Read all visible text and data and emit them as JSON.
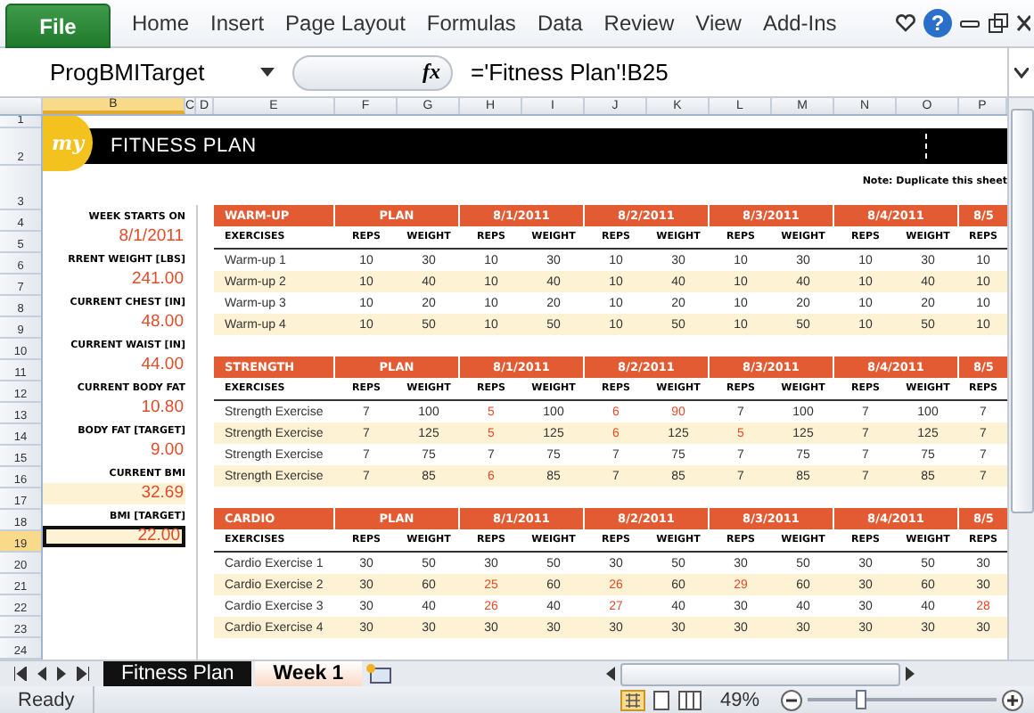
{
  "ribbon": {
    "file_label": "File",
    "tabs": [
      "Home",
      "Insert",
      "Page Layout",
      "Formulas",
      "Data",
      "Review",
      "View",
      "Add-Ins"
    ],
    "help_label": "?"
  },
  "formula_bar": {
    "name_box": "ProgBMITarget",
    "fx_label": "fx",
    "formula": "='Fitness Plan'!B25"
  },
  "column_headers": [
    {
      "label": "B",
      "selected": true
    },
    {
      "label": "C",
      "selected": false
    },
    {
      "label": "D",
      "selected": false
    },
    {
      "label": "E",
      "selected": false
    },
    {
      "label": "F",
      "selected": false
    },
    {
      "label": "G",
      "selected": false
    },
    {
      "label": "H",
      "selected": false
    },
    {
      "label": "I",
      "selected": false
    },
    {
      "label": "J",
      "selected": false
    },
    {
      "label": "K",
      "selected": false
    },
    {
      "label": "L",
      "selected": false
    },
    {
      "label": "M",
      "selected": false
    },
    {
      "label": "N",
      "selected": false
    },
    {
      "label": "O",
      "selected": false
    },
    {
      "label": "P",
      "selected": false
    }
  ],
  "row_headers": [
    {
      "label": "1",
      "selected": false
    },
    {
      "label": "2",
      "selected": false
    },
    {
      "label": "3",
      "selected": false
    },
    {
      "label": "4",
      "selected": false
    },
    {
      "label": "5",
      "selected": false
    },
    {
      "label": "6",
      "selected": false
    },
    {
      "label": "7",
      "selected": false
    },
    {
      "label": "8",
      "selected": false
    },
    {
      "label": "9",
      "selected": false
    },
    {
      "label": "10",
      "selected": false
    },
    {
      "label": "11",
      "selected": false
    },
    {
      "label": "12",
      "selected": false
    },
    {
      "label": "13",
      "selected": false
    },
    {
      "label": "14",
      "selected": false
    },
    {
      "label": "15",
      "selected": false
    },
    {
      "label": "16",
      "selected": false
    },
    {
      "label": "17",
      "selected": false
    },
    {
      "label": "18",
      "selected": false
    },
    {
      "label": "19",
      "selected": true
    },
    {
      "label": "20",
      "selected": false
    },
    {
      "label": "21",
      "selected": false
    },
    {
      "label": "22",
      "selected": false
    },
    {
      "label": "23",
      "selected": false
    },
    {
      "label": "24",
      "selected": false
    }
  ],
  "banner": {
    "logo": "my",
    "title": "FITNESS PLAN",
    "note": "Note: Duplicate this sheet"
  },
  "stats": [
    {
      "label": "WEEK STARTS ON",
      "value": "8/1/2011",
      "highlighted": false,
      "selected": false
    },
    {
      "label": "RRENT WEIGHT [LBS]",
      "value": "241.00",
      "highlighted": false,
      "selected": false
    },
    {
      "label": "CURRENT CHEST [IN]",
      "value": "48.00",
      "highlighted": false,
      "selected": false
    },
    {
      "label": "CURRENT WAIST [IN]",
      "value": "44.00",
      "highlighted": false,
      "selected": false
    },
    {
      "label": "CURRENT BODY FAT",
      "value": "10.80",
      "highlighted": false,
      "selected": false
    },
    {
      "label": "BODY FAT [TARGET]",
      "value": "9.00",
      "highlighted": false,
      "selected": false
    },
    {
      "label": "CURRENT BMI",
      "value": "32.69",
      "highlighted": true,
      "selected": false
    },
    {
      "label": "BMI [TARGET]",
      "value": "22.00",
      "highlighted": true,
      "selected": true
    }
  ],
  "sections": [
    {
      "title": "WARM-UP",
      "groups": [
        "PLAN",
        "8/1/2011",
        "8/2/2011",
        "8/3/2011",
        "8/4/2011",
        "8/5"
      ],
      "column_labels": [
        "EXERCISES",
        "REPS",
        "WEIGHT",
        "REPS",
        "WEIGHT",
        "REPS",
        "WEIGHT",
        "REPS",
        "WEIGHT",
        "REPS",
        "WEIGHT",
        "REPS"
      ],
      "rows": [
        {
          "exercise": "Warm-up 1",
          "cells": [
            {
              "text": "10",
              "flagged": false
            },
            {
              "text": "30",
              "flagged": false
            },
            {
              "text": "10",
              "flagged": false
            },
            {
              "text": "30",
              "flagged": false
            },
            {
              "text": "10",
              "flagged": false
            },
            {
              "text": "30",
              "flagged": false
            },
            {
              "text": "10",
              "flagged": false
            },
            {
              "text": "30",
              "flagged": false
            },
            {
              "text": "10",
              "flagged": false
            },
            {
              "text": "30",
              "flagged": false
            },
            {
              "text": "10",
              "flagged": false
            }
          ]
        },
        {
          "exercise": "Warm-up 2",
          "cells": [
            {
              "text": "10",
              "flagged": false
            },
            {
              "text": "40",
              "flagged": false
            },
            {
              "text": "10",
              "flagged": false
            },
            {
              "text": "40",
              "flagged": false
            },
            {
              "text": "10",
              "flagged": false
            },
            {
              "text": "40",
              "flagged": false
            },
            {
              "text": "10",
              "flagged": false
            },
            {
              "text": "40",
              "flagged": false
            },
            {
              "text": "10",
              "flagged": false
            },
            {
              "text": "40",
              "flagged": false
            },
            {
              "text": "10",
              "flagged": false
            }
          ]
        },
        {
          "exercise": "Warm-up 3",
          "cells": [
            {
              "text": "10",
              "flagged": false
            },
            {
              "text": "20",
              "flagged": false
            },
            {
              "text": "10",
              "flagged": false
            },
            {
              "text": "20",
              "flagged": false
            },
            {
              "text": "10",
              "flagged": false
            },
            {
              "text": "20",
              "flagged": false
            },
            {
              "text": "10",
              "flagged": false
            },
            {
              "text": "20",
              "flagged": false
            },
            {
              "text": "10",
              "flagged": false
            },
            {
              "text": "20",
              "flagged": false
            },
            {
              "text": "10",
              "flagged": false
            }
          ]
        },
        {
          "exercise": "Warm-up 4",
          "cells": [
            {
              "text": "10",
              "flagged": false
            },
            {
              "text": "50",
              "flagged": false
            },
            {
              "text": "10",
              "flagged": false
            },
            {
              "text": "50",
              "flagged": false
            },
            {
              "text": "10",
              "flagged": false
            },
            {
              "text": "50",
              "flagged": false
            },
            {
              "text": "10",
              "flagged": false
            },
            {
              "text": "50",
              "flagged": false
            },
            {
              "text": "10",
              "flagged": false
            },
            {
              "text": "50",
              "flagged": false
            },
            {
              "text": "10",
              "flagged": false
            }
          ]
        }
      ]
    },
    {
      "title": "STRENGTH",
      "groups": [
        "PLAN",
        "8/1/2011",
        "8/2/2011",
        "8/3/2011",
        "8/4/2011",
        "8/5"
      ],
      "column_labels": [
        "EXERCISES",
        "REPS",
        "WEIGHT",
        "REPS",
        "WEIGHT",
        "REPS",
        "WEIGHT",
        "REPS",
        "WEIGHT",
        "REPS",
        "WEIGHT",
        "REPS"
      ],
      "rows": [
        {
          "exercise": "Strength Exercise",
          "cells": [
            {
              "text": "7",
              "flagged": false
            },
            {
              "text": "100",
              "flagged": false
            },
            {
              "text": "5",
              "flagged": true
            },
            {
              "text": "100",
              "flagged": false
            },
            {
              "text": "6",
              "flagged": true
            },
            {
              "text": "90",
              "flagged": true
            },
            {
              "text": "7",
              "flagged": false
            },
            {
              "text": "100",
              "flagged": false
            },
            {
              "text": "7",
              "flagged": false
            },
            {
              "text": "100",
              "flagged": false
            },
            {
              "text": "7",
              "flagged": false
            }
          ]
        },
        {
          "exercise": "Strength Exercise",
          "cells": [
            {
              "text": "7",
              "flagged": false
            },
            {
              "text": "125",
              "flagged": false
            },
            {
              "text": "5",
              "flagged": true
            },
            {
              "text": "125",
              "flagged": false
            },
            {
              "text": "6",
              "flagged": true
            },
            {
              "text": "125",
              "flagged": false
            },
            {
              "text": "5",
              "flagged": true
            },
            {
              "text": "125",
              "flagged": false
            },
            {
              "text": "7",
              "flagged": false
            },
            {
              "text": "125",
              "flagged": false
            },
            {
              "text": "7",
              "flagged": false
            }
          ]
        },
        {
          "exercise": "Strength Exercise",
          "cells": [
            {
              "text": "7",
              "flagged": false
            },
            {
              "text": "75",
              "flagged": false
            },
            {
              "text": "7",
              "flagged": false
            },
            {
              "text": "75",
              "flagged": false
            },
            {
              "text": "7",
              "flagged": false
            },
            {
              "text": "75",
              "flagged": false
            },
            {
              "text": "7",
              "flagged": false
            },
            {
              "text": "75",
              "flagged": false
            },
            {
              "text": "7",
              "flagged": false
            },
            {
              "text": "75",
              "flagged": false
            },
            {
              "text": "7",
              "flagged": false
            }
          ]
        },
        {
          "exercise": "Strength Exercise",
          "cells": [
            {
              "text": "7",
              "flagged": false
            },
            {
              "text": "85",
              "flagged": false
            },
            {
              "text": "6",
              "flagged": true
            },
            {
              "text": "85",
              "flagged": false
            },
            {
              "text": "7",
              "flagged": false
            },
            {
              "text": "85",
              "flagged": false
            },
            {
              "text": "7",
              "flagged": false
            },
            {
              "text": "85",
              "flagged": false
            },
            {
              "text": "7",
              "flagged": false
            },
            {
              "text": "85",
              "flagged": false
            },
            {
              "text": "7",
              "flagged": false
            }
          ]
        }
      ]
    },
    {
      "title": "CARDIO",
      "groups": [
        "PLAN",
        "8/1/2011",
        "8/2/2011",
        "8/3/2011",
        "8/4/2011",
        "8/5"
      ],
      "column_labels": [
        "EXERCISES",
        "REPS",
        "WEIGHT",
        "REPS",
        "WEIGHT",
        "REPS",
        "WEIGHT",
        "REPS",
        "WEIGHT",
        "REPS",
        "WEIGHT",
        "REPS"
      ],
      "rows": [
        {
          "exercise": "Cardio Exercise 1",
          "cells": [
            {
              "text": "30",
              "flagged": false
            },
            {
              "text": "50",
              "flagged": false
            },
            {
              "text": "30",
              "flagged": false
            },
            {
              "text": "50",
              "flagged": false
            },
            {
              "text": "30",
              "flagged": false
            },
            {
              "text": "50",
              "flagged": false
            },
            {
              "text": "30",
              "flagged": false
            },
            {
              "text": "50",
              "flagged": false
            },
            {
              "text": "30",
              "flagged": false
            },
            {
              "text": "50",
              "flagged": false
            },
            {
              "text": "30",
              "flagged": false
            }
          ]
        },
        {
          "exercise": "Cardio Exercise 2",
          "cells": [
            {
              "text": "30",
              "flagged": false
            },
            {
              "text": "60",
              "flagged": false
            },
            {
              "text": "25",
              "flagged": true
            },
            {
              "text": "60",
              "flagged": false
            },
            {
              "text": "26",
              "flagged": true
            },
            {
              "text": "60",
              "flagged": false
            },
            {
              "text": "29",
              "flagged": true
            },
            {
              "text": "60",
              "flagged": false
            },
            {
              "text": "30",
              "flagged": false
            },
            {
              "text": "60",
              "flagged": false
            },
            {
              "text": "30",
              "flagged": false
            }
          ]
        },
        {
          "exercise": "Cardio Exercise 3",
          "cells": [
            {
              "text": "30",
              "flagged": false
            },
            {
              "text": "40",
              "flagged": false
            },
            {
              "text": "26",
              "flagged": true
            },
            {
              "text": "40",
              "flagged": false
            },
            {
              "text": "27",
              "flagged": true
            },
            {
              "text": "40",
              "flagged": false
            },
            {
              "text": "30",
              "flagged": false
            },
            {
              "text": "40",
              "flagged": false
            },
            {
              "text": "30",
              "flagged": false
            },
            {
              "text": "40",
              "flagged": false
            },
            {
              "text": "28",
              "flagged": true
            }
          ]
        },
        {
          "exercise": "Cardio Exercise 4",
          "cells": [
            {
              "text": "30",
              "flagged": false
            },
            {
              "text": "30",
              "flagged": false
            },
            {
              "text": "30",
              "flagged": false
            },
            {
              "text": "30",
              "flagged": false
            },
            {
              "text": "30",
              "flagged": false
            },
            {
              "text": "30",
              "flagged": false
            },
            {
              "text": "30",
              "flagged": false
            },
            {
              "text": "30",
              "flagged": false
            },
            {
              "text": "30",
              "flagged": false
            },
            {
              "text": "30",
              "flagged": false
            },
            {
              "text": "30",
              "flagged": false
            }
          ]
        }
      ]
    }
  ],
  "sheet_tabs": [
    {
      "label": "Fitness Plan",
      "selected": false
    },
    {
      "label": "Week 1",
      "selected": true
    }
  ],
  "status_bar": {
    "text": "Ready",
    "zoom": "49%",
    "zoom_slider": {
      "level": 0.27
    }
  }
}
